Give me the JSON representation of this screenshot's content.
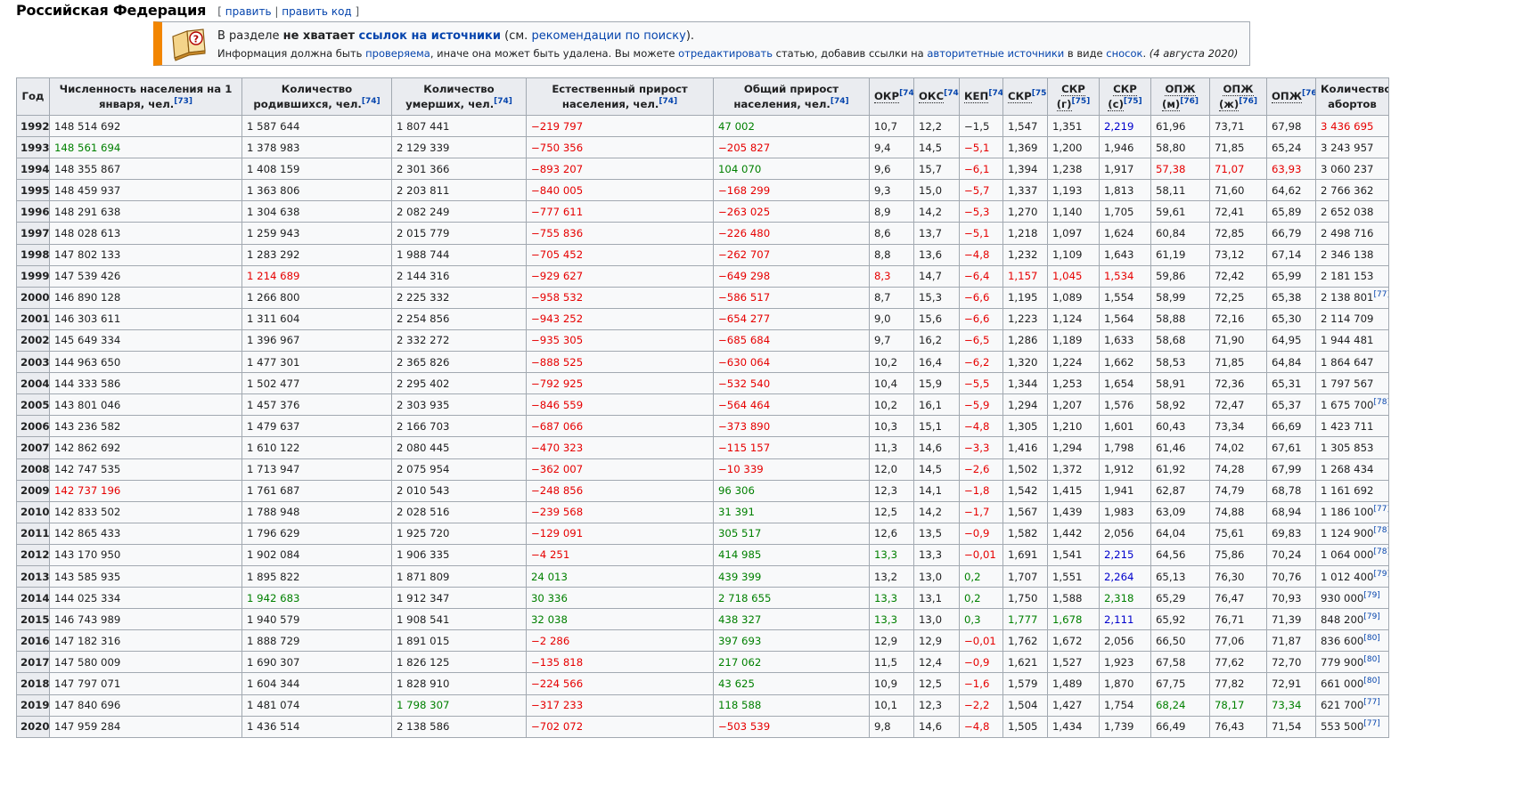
{
  "heading": {
    "title": "Российская Федерация",
    "bracket_open": "[",
    "edit": "править",
    "separator": "|",
    "edit_code": "править код",
    "bracket_close": "]"
  },
  "ambox": {
    "icon": "book-question-icon",
    "line1_pre": "В разделе ",
    "line1_bold": "не хватает ",
    "line1_link_bold": "ссылок на источники",
    "line1_mid": " (см. ",
    "line1_link": "рекомендации по поиску",
    "line1_end": ").",
    "line2_a": "Информация должна быть ",
    "line2_link1": "проверяема",
    "line2_b": ", иначе она может быть удалена. Вы можете ",
    "line2_link2": "отредактировать",
    "line2_c": " статью, добавив ссылки на ",
    "line2_link3": "авторитетные источники",
    "line2_d": " в виде ",
    "line2_link4": "сносок",
    "line2_e": ". ",
    "line2_date": "(4 августа 2020)"
  },
  "table": {
    "headers": [
      {
        "text": "Год",
        "ref": ""
      },
      {
        "text": "Численность населения на 1 января, чел.",
        "ref": "[73]"
      },
      {
        "text": "Количество родившихся, чел.",
        "ref": "[74]"
      },
      {
        "text": "Количество умерших, чел.",
        "ref": "[74]"
      },
      {
        "text": "Естественный прирост населения, чел.",
        "ref": "[74]"
      },
      {
        "text": "Общий прирост населения, чел.",
        "ref": "[74]"
      },
      {
        "text": "ОКР",
        "ref": "[74]"
      },
      {
        "text": "ОКС",
        "ref": "[74]"
      },
      {
        "text": "КЕП",
        "ref": "[74]"
      },
      {
        "text": "СКР",
        "ref": "[75]"
      },
      {
        "text": "СКР (г)",
        "ref": "[75]"
      },
      {
        "text": "СКР (с)",
        "ref": "[75]"
      },
      {
        "text": "ОПЖ (м)",
        "ref": "[76]"
      },
      {
        "text": "ОПЖ (ж)",
        "ref": "[76]"
      },
      {
        "text": "ОПЖ",
        "ref": "[76]"
      },
      {
        "text": "Количество абортов",
        "ref": ""
      }
    ],
    "rows": [
      [
        "1992",
        "148 514 692",
        "1 587 644",
        "1 807 441",
        "−219 797",
        "47 002",
        "10,7",
        "12,2",
        "−1,5",
        "1,547",
        "1,351",
        "2,219",
        "61,96",
        "73,71",
        "67,98",
        "3 436 695"
      ],
      [
        "1993",
        "148 561 694",
        "1 378 983",
        "2 129 339",
        "−750 356",
        "−205 827",
        "9,4",
        "14,5",
        "−5,1",
        "1,369",
        "1,200",
        "1,946",
        "58,80",
        "71,85",
        "65,24",
        "3 243 957"
      ],
      [
        "1994",
        "148 355 867",
        "1 408 159",
        "2 301 366",
        "−893 207",
        "104 070",
        "9,6",
        "15,7",
        "−6,1",
        "1,394",
        "1,238",
        "1,917",
        "57,38",
        "71,07",
        "63,93",
        "3 060 237"
      ],
      [
        "1995",
        "148 459 937",
        "1 363 806",
        "2 203 811",
        "−840 005",
        "−168 299",
        "9,3",
        "15,0",
        "−5,7",
        "1,337",
        "1,193",
        "1,813",
        "58,11",
        "71,60",
        "64,62",
        "2 766 362"
      ],
      [
        "1996",
        "148 291 638",
        "1 304 638",
        "2 082 249",
        "−777 611",
        "−263 025",
        "8,9",
        "14,2",
        "−5,3",
        "1,270",
        "1,140",
        "1,705",
        "59,61",
        "72,41",
        "65,89",
        "2 652 038"
      ],
      [
        "1997",
        "148 028 613",
        "1 259 943",
        "2 015 779",
        "−755 836",
        "−226 480",
        "8,6",
        "13,7",
        "−5,1",
        "1,218",
        "1,097",
        "1,624",
        "60,84",
        "72,85",
        "66,79",
        "2 498 716"
      ],
      [
        "1998",
        "147 802 133",
        "1 283 292",
        "1 988 744",
        "−705 452",
        "−262 707",
        "8,8",
        "13,6",
        "−4,8",
        "1,232",
        "1,109",
        "1,643",
        "61,19",
        "73,12",
        "67,14",
        "2 346 138"
      ],
      [
        "1999",
        "147 539 426",
        "1 214 689",
        "2 144 316",
        "−929 627",
        "−649 298",
        "8,3",
        "14,7",
        "−6,4",
        "1,157",
        "1,045",
        "1,534",
        "59,86",
        "72,42",
        "65,99",
        "2 181 153"
      ],
      [
        "2000",
        "146 890 128",
        "1 266 800",
        "2 225 332",
        "−958 532",
        "−586 517",
        "8,7",
        "15,3",
        "−6,6",
        "1,195",
        "1,089",
        "1,554",
        "58,99",
        "72,25",
        "65,38",
        "2 138 801"
      ],
      [
        "2001",
        "146 303 611",
        "1 311 604",
        "2 254 856",
        "−943 252",
        "−654 277",
        "9,0",
        "15,6",
        "−6,6",
        "1,223",
        "1,124",
        "1,564",
        "58,88",
        "72,16",
        "65,30",
        "2 114 709"
      ],
      [
        "2002",
        "145 649 334",
        "1 396 967",
        "2 332 272",
        "−935 305",
        "−685 684",
        "9,7",
        "16,2",
        "−6,5",
        "1,286",
        "1,189",
        "1,633",
        "58,68",
        "71,90",
        "64,95",
        "1 944 481"
      ],
      [
        "2003",
        "144 963 650",
        "1 477 301",
        "2 365 826",
        "−888 525",
        "−630 064",
        "10,2",
        "16,4",
        "−6,2",
        "1,320",
        "1,224",
        "1,662",
        "58,53",
        "71,85",
        "64,84",
        "1 864 647"
      ],
      [
        "2004",
        "144 333 586",
        "1 502 477",
        "2 295 402",
        "−792 925",
        "−532 540",
        "10,4",
        "15,9",
        "−5,5",
        "1,344",
        "1,253",
        "1,654",
        "58,91",
        "72,36",
        "65,31",
        "1 797 567"
      ],
      [
        "2005",
        "143 801 046",
        "1 457 376",
        "2 303 935",
        "−846 559",
        "−564 464",
        "10,2",
        "16,1",
        "−5,9",
        "1,294",
        "1,207",
        "1,576",
        "58,92",
        "72,47",
        "65,37",
        "1 675 700"
      ],
      [
        "2006",
        "143 236 582",
        "1 479 637",
        "2 166 703",
        "−687 066",
        "−373 890",
        "10,3",
        "15,1",
        "−4,8",
        "1,305",
        "1,210",
        "1,601",
        "60,43",
        "73,34",
        "66,69",
        "1 423 711"
      ],
      [
        "2007",
        "142 862 692",
        "1 610 122",
        "2 080 445",
        "−470 323",
        "−115 157",
        "11,3",
        "14,6",
        "−3,3",
        "1,416",
        "1,294",
        "1,798",
        "61,46",
        "74,02",
        "67,61",
        "1 305 853"
      ],
      [
        "2008",
        "142 747 535",
        "1 713 947",
        "2 075 954",
        "−362 007",
        "−10 339",
        "12,0",
        "14,5",
        "−2,6",
        "1,502",
        "1,372",
        "1,912",
        "61,92",
        "74,28",
        "67,99",
        "1 268 434"
      ],
      [
        "2009",
        "142 737 196",
        "1 761 687",
        "2 010 543",
        "−248 856",
        "96 306",
        "12,3",
        "14,1",
        "−1,8",
        "1,542",
        "1,415",
        "1,941",
        "62,87",
        "74,79",
        "68,78",
        "1 161 692"
      ],
      [
        "2010",
        "142 833 502",
        "1 788 948",
        "2 028 516",
        "−239 568",
        "31 391",
        "12,5",
        "14,2",
        "−1,7",
        "1,567",
        "1,439",
        "1,983",
        "63,09",
        "74,88",
        "68,94",
        "1 186 100"
      ],
      [
        "2011",
        "142 865 433",
        "1 796 629",
        "1 925 720",
        "−129 091",
        "305 517",
        "12,6",
        "13,5",
        "−0,9",
        "1,582",
        "1,442",
        "2,056",
        "64,04",
        "75,61",
        "69,83",
        "1 124 900"
      ],
      [
        "2012",
        "143 170 950",
        "1 902 084",
        "1 906 335",
        "−4 251",
        "414 985",
        "13,3",
        "13,3",
        "−0,01",
        "1,691",
        "1,541",
        "2,215",
        "64,56",
        "75,86",
        "70,24",
        "1 064 000"
      ],
      [
        "2013",
        "143 585 935",
        "1 895 822",
        "1 871 809",
        "24 013",
        "439 399",
        "13,2",
        "13,0",
        "0,2",
        "1,707",
        "1,551",
        "2,264",
        "65,13",
        "76,30",
        "70,76",
        "1 012 400"
      ],
      [
        "2014",
        "144 025 334",
        "1 942 683",
        "1 912 347",
        "30 336",
        "2 718 655",
        "13,3",
        "13,1",
        "0,2",
        "1,750",
        "1,588",
        "2,318",
        "65,29",
        "76,47",
        "70,93",
        "930 000"
      ],
      [
        "2015",
        "146 743 989",
        "1 940 579",
        "1 908 541",
        "32 038",
        "438 327",
        "13,3",
        "13,0",
        "0,3",
        "1,777",
        "1,678",
        "2,111",
        "65,92",
        "76,71",
        "71,39",
        "848 200"
      ],
      [
        "2016",
        "147 182 316",
        "1 888 729",
        "1 891 015",
        "−2 286",
        "397 693",
        "12,9",
        "12,9",
        "−0,01",
        "1,762",
        "1,672",
        "2,056",
        "66,50",
        "77,06",
        "71,87",
        "836 600"
      ],
      [
        "2017",
        "147 580 009",
        "1 690 307",
        "1 826 125",
        "−135 818",
        "217 062",
        "11,5",
        "12,4",
        "−0,9",
        "1,621",
        "1,527",
        "1,923",
        "67,58",
        "77,62",
        "72,70",
        "779 900"
      ],
      [
        "2018",
        "147 797 071",
        "1 604 344",
        "1 828 910",
        "−224 566",
        "43 625",
        "10,9",
        "12,5",
        "−1,6",
        "1,579",
        "1,489",
        "1,870",
        "67,75",
        "77,82",
        "72,91",
        "661 000"
      ],
      [
        "2019",
        "147 840 696",
        "1 481 074",
        "1 798 307",
        "−317 233",
        "118 588",
        "10,1",
        "12,3",
        "−2,2",
        "1,504",
        "1,427",
        "1,754",
        "68,24",
        "78,17",
        "73,34",
        "621 700"
      ],
      [
        "2020",
        "147 959 284",
        "1 436 514",
        "2 138 586",
        "−702 072",
        "−503 539",
        "9,8",
        "14,6",
        "−4,8",
        "1,505",
        "1,434",
        "1,739",
        "66,49",
        "76,43",
        "71,54",
        "553 500"
      ]
    ],
    "abortion_refs": {
      "2000": "[77]",
      "2005": "[78]",
      "2010": "[77]",
      "2011": "[78]",
      "2012": "[78]",
      "2013": "[79]",
      "2014": "[79]",
      "2015": "[79]",
      "2016": "[80]",
      "2017": "[80]",
      "2018": "[80]",
      "2019": "[77]",
      "2020": "[77]"
    },
    "highlights": {
      "1992": {
        "4": "red",
        "5": "green",
        "11": "blue",
        "15": "red"
      },
      "1993": {
        "1": "green",
        "4": "red",
        "5": "red",
        "8": "red"
      },
      "1994": {
        "4": "red",
        "5": "green",
        "8": "red",
        "12": "red",
        "13": "red",
        "14": "red"
      },
      "1995": {
        "4": "red",
        "5": "red",
        "8": "red"
      },
      "1996": {
        "4": "red",
        "5": "red",
        "8": "red"
      },
      "1997": {
        "4": "red",
        "5": "red",
        "8": "red"
      },
      "1998": {
        "4": "red",
        "5": "red",
        "8": "red"
      },
      "1999": {
        "2": "red",
        "4": "red",
        "5": "red",
        "6": "red",
        "8": "red",
        "9": "red",
        "10": "red",
        "11": "red"
      },
      "2000": {
        "4": "red",
        "5": "red",
        "8": "red"
      },
      "2001": {
        "4": "red",
        "5": "red",
        "8": "red"
      },
      "2002": {
        "4": "red",
        "5": "red",
        "8": "red"
      },
      "2003": {
        "4": "red",
        "5": "red",
        "8": "red"
      },
      "2004": {
        "4": "red",
        "5": "red",
        "8": "red"
      },
      "2005": {
        "4": "red",
        "5": "red",
        "8": "red"
      },
      "2006": {
        "4": "red",
        "5": "red",
        "8": "red"
      },
      "2007": {
        "4": "red",
        "5": "red",
        "8": "red"
      },
      "2008": {
        "4": "red",
        "5": "red",
        "8": "red"
      },
      "2009": {
        "1": "red",
        "4": "red",
        "5": "green",
        "8": "red"
      },
      "2010": {
        "4": "red",
        "5": "green",
        "8": "red"
      },
      "2011": {
        "4": "red",
        "5": "green",
        "8": "red"
      },
      "2012": {
        "4": "red",
        "5": "green",
        "6": "green",
        "8": "red",
        "11": "blue"
      },
      "2013": {
        "4": "green",
        "5": "green",
        "8": "green",
        "11": "blue"
      },
      "2014": {
        "2": "green",
        "4": "green",
        "5": "green",
        "6": "green",
        "8": "green",
        "11": "green"
      },
      "2015": {
        "4": "green",
        "5": "green",
        "6": "green",
        "8": "green",
        "9": "green",
        "10": "green",
        "11": "blue"
      },
      "2016": {
        "4": "red",
        "5": "green",
        "8": "red"
      },
      "2017": {
        "4": "red",
        "5": "green",
        "8": "red"
      },
      "2018": {
        "4": "red",
        "5": "green",
        "8": "red"
      },
      "2019": {
        "3": "green",
        "4": "red",
        "5": "green",
        "8": "red",
        "12": "green",
        "13": "green",
        "14": "green"
      },
      "2020": {
        "4": "red",
        "5": "red",
        "8": "red"
      }
    },
    "colors": {
      "red": "#e60000",
      "green": "#008000",
      "blue": "#0000cc",
      "link": "#0645ad",
      "header_bg": "#eaecf0",
      "border": "#a2a9b1",
      "ambox_accent": "#f28500"
    }
  }
}
